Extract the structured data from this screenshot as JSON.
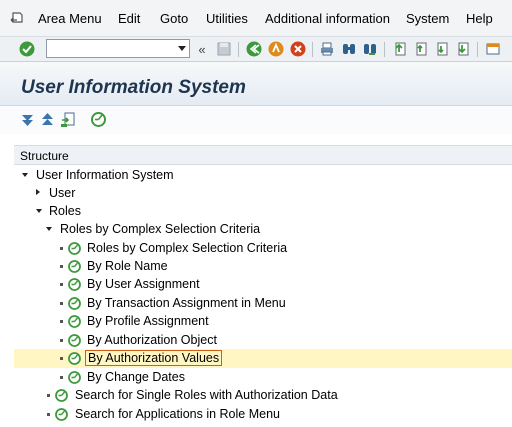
{
  "menu": {
    "items": [
      "Area Menu",
      "Edit",
      "Goto",
      "Utilities",
      "Additional information",
      "System",
      "Help"
    ]
  },
  "toolbar": {
    "command_field_value": "",
    "collapse_glyph": "«"
  },
  "title": "User Information System",
  "tree": {
    "header": "Structure",
    "nodes": [
      "User Information System",
      "User",
      "Roles",
      "Roles by Complex Selection Criteria",
      "Roles by Complex Selection Criteria",
      "By Role Name",
      "By User Assignment",
      "By Transaction Assignment in Menu",
      "By Profile Assignment",
      "By Authorization Object",
      "By Authorization Values",
      "By Change Dates",
      "Search for Single Roles with Authorization Data",
      "Search for Applications in Role Menu"
    ]
  },
  "colors": {
    "accent_green": "#3c9a3c",
    "selected_row": "#fff6c4",
    "title_text": "#1d3550",
    "focus_border": "#d06010"
  }
}
